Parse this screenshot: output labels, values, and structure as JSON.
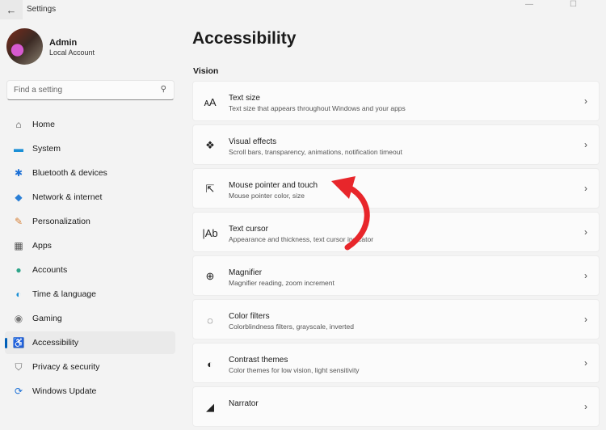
{
  "window": {
    "title": "Settings",
    "minimize": "—",
    "maximize": "☐"
  },
  "profile": {
    "name": "Admin",
    "account": "Local Account"
  },
  "search": {
    "placeholder": "Find a setting"
  },
  "nav": [
    {
      "label": "Home",
      "icon": "home-icon",
      "glyph": "⌂",
      "color": "#444"
    },
    {
      "label": "System",
      "icon": "system-icon",
      "glyph": "▬",
      "color": "#1a8fd6"
    },
    {
      "label": "Bluetooth & devices",
      "icon": "bluetooth-icon",
      "glyph": "✱",
      "color": "#1a6fd6"
    },
    {
      "label": "Network & internet",
      "icon": "wifi-icon",
      "glyph": "◆",
      "color": "#2a7fd6"
    },
    {
      "label": "Personalization",
      "icon": "brush-icon",
      "glyph": "✎",
      "color": "#d6823a"
    },
    {
      "label": "Apps",
      "icon": "apps-icon",
      "glyph": "▦",
      "color": "#555"
    },
    {
      "label": "Accounts",
      "icon": "accounts-icon",
      "glyph": "●",
      "color": "#2fa58a"
    },
    {
      "label": "Time & language",
      "icon": "globe-icon",
      "glyph": "◐",
      "color": "#1a8fd6"
    },
    {
      "label": "Gaming",
      "icon": "gaming-icon",
      "glyph": "◉",
      "color": "#777"
    },
    {
      "label": "Accessibility",
      "icon": "accessibility-icon",
      "glyph": "♿",
      "color": "#1a6fd6"
    },
    {
      "label": "Privacy & security",
      "icon": "shield-icon",
      "glyph": "⛉",
      "color": "#666"
    },
    {
      "label": "Windows Update",
      "icon": "update-icon",
      "glyph": "⟳",
      "color": "#1a6fd6"
    }
  ],
  "selected_nav": "Accessibility",
  "page": {
    "title": "Accessibility",
    "section": "Vision"
  },
  "cards": [
    {
      "title": "Text size",
      "subtitle": "Text size that appears throughout Windows and your apps",
      "icon": "text-size-icon",
      "glyph": "ᴀA"
    },
    {
      "title": "Visual effects",
      "subtitle": "Scroll bars, transparency, animations, notification timeout",
      "icon": "visual-effects-icon",
      "glyph": "❖"
    },
    {
      "title": "Mouse pointer and touch",
      "subtitle": "Mouse pointer color, size",
      "icon": "mouse-pointer-icon",
      "glyph": "⇱"
    },
    {
      "title": "Text cursor",
      "subtitle": "Appearance and thickness, text cursor indicator",
      "icon": "text-cursor-icon",
      "glyph": "|Ab"
    },
    {
      "title": "Magnifier",
      "subtitle": "Magnifier reading, zoom increment",
      "icon": "magnifier-icon",
      "glyph": "⊕"
    },
    {
      "title": "Color filters",
      "subtitle": "Colorblindness filters, grayscale, inverted",
      "icon": "palette-icon",
      "glyph": "◌"
    },
    {
      "title": "Contrast themes",
      "subtitle": "Color themes for low vision, light sensitivity",
      "icon": "contrast-icon",
      "glyph": "◐"
    },
    {
      "title": "Narrator",
      "subtitle": "",
      "icon": "narrator-icon",
      "glyph": "◢"
    }
  ],
  "annotation_color": "#e8262b"
}
